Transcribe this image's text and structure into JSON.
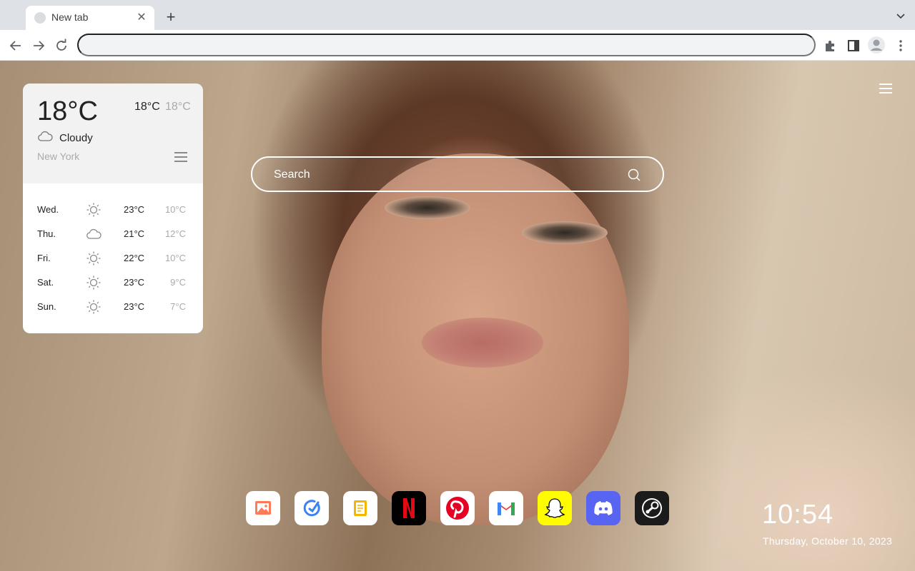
{
  "browser": {
    "tab": {
      "title": "New tab"
    },
    "omnibox": {
      "value": "",
      "placeholder": ""
    }
  },
  "weather": {
    "current_temp": "18°C",
    "high": "18°C",
    "low": "18°C",
    "condition": "Cloudy",
    "city": "New York",
    "forecast": [
      {
        "day": "Wed.",
        "icon": "sun-icon",
        "high": "23°C",
        "low": "10°C"
      },
      {
        "day": "Thu.",
        "icon": "cloud-icon",
        "high": "21°C",
        "low": "12°C"
      },
      {
        "day": "Fri.",
        "icon": "sun-icon",
        "high": "22°C",
        "low": "10°C"
      },
      {
        "day": "Sat.",
        "icon": "sun-icon",
        "high": "23°C",
        "low": "9°C"
      },
      {
        "day": "Sun.",
        "icon": "sun-icon",
        "high": "23°C",
        "low": "7°C"
      }
    ]
  },
  "search": {
    "placeholder": "Search"
  },
  "apps": [
    {
      "name": "photos-app-icon"
    },
    {
      "name": "tasks-app-icon"
    },
    {
      "name": "notes-app-icon"
    },
    {
      "name": "netflix-app-icon"
    },
    {
      "name": "pinterest-app-icon"
    },
    {
      "name": "gmail-app-icon"
    },
    {
      "name": "snapchat-app-icon"
    },
    {
      "name": "discord-app-icon"
    },
    {
      "name": "steam-app-icon"
    }
  ],
  "clock": {
    "time": "10:54",
    "date": "Thursday, October 10, 2023"
  },
  "colors": {
    "netflix": "#000000",
    "netflix_red": "#e50914",
    "pinterest": "#e60023",
    "snapchat": "#fffc00",
    "discord": "#5865f2",
    "steam": "#1b1b1b",
    "gmail_red": "#ea4335"
  }
}
